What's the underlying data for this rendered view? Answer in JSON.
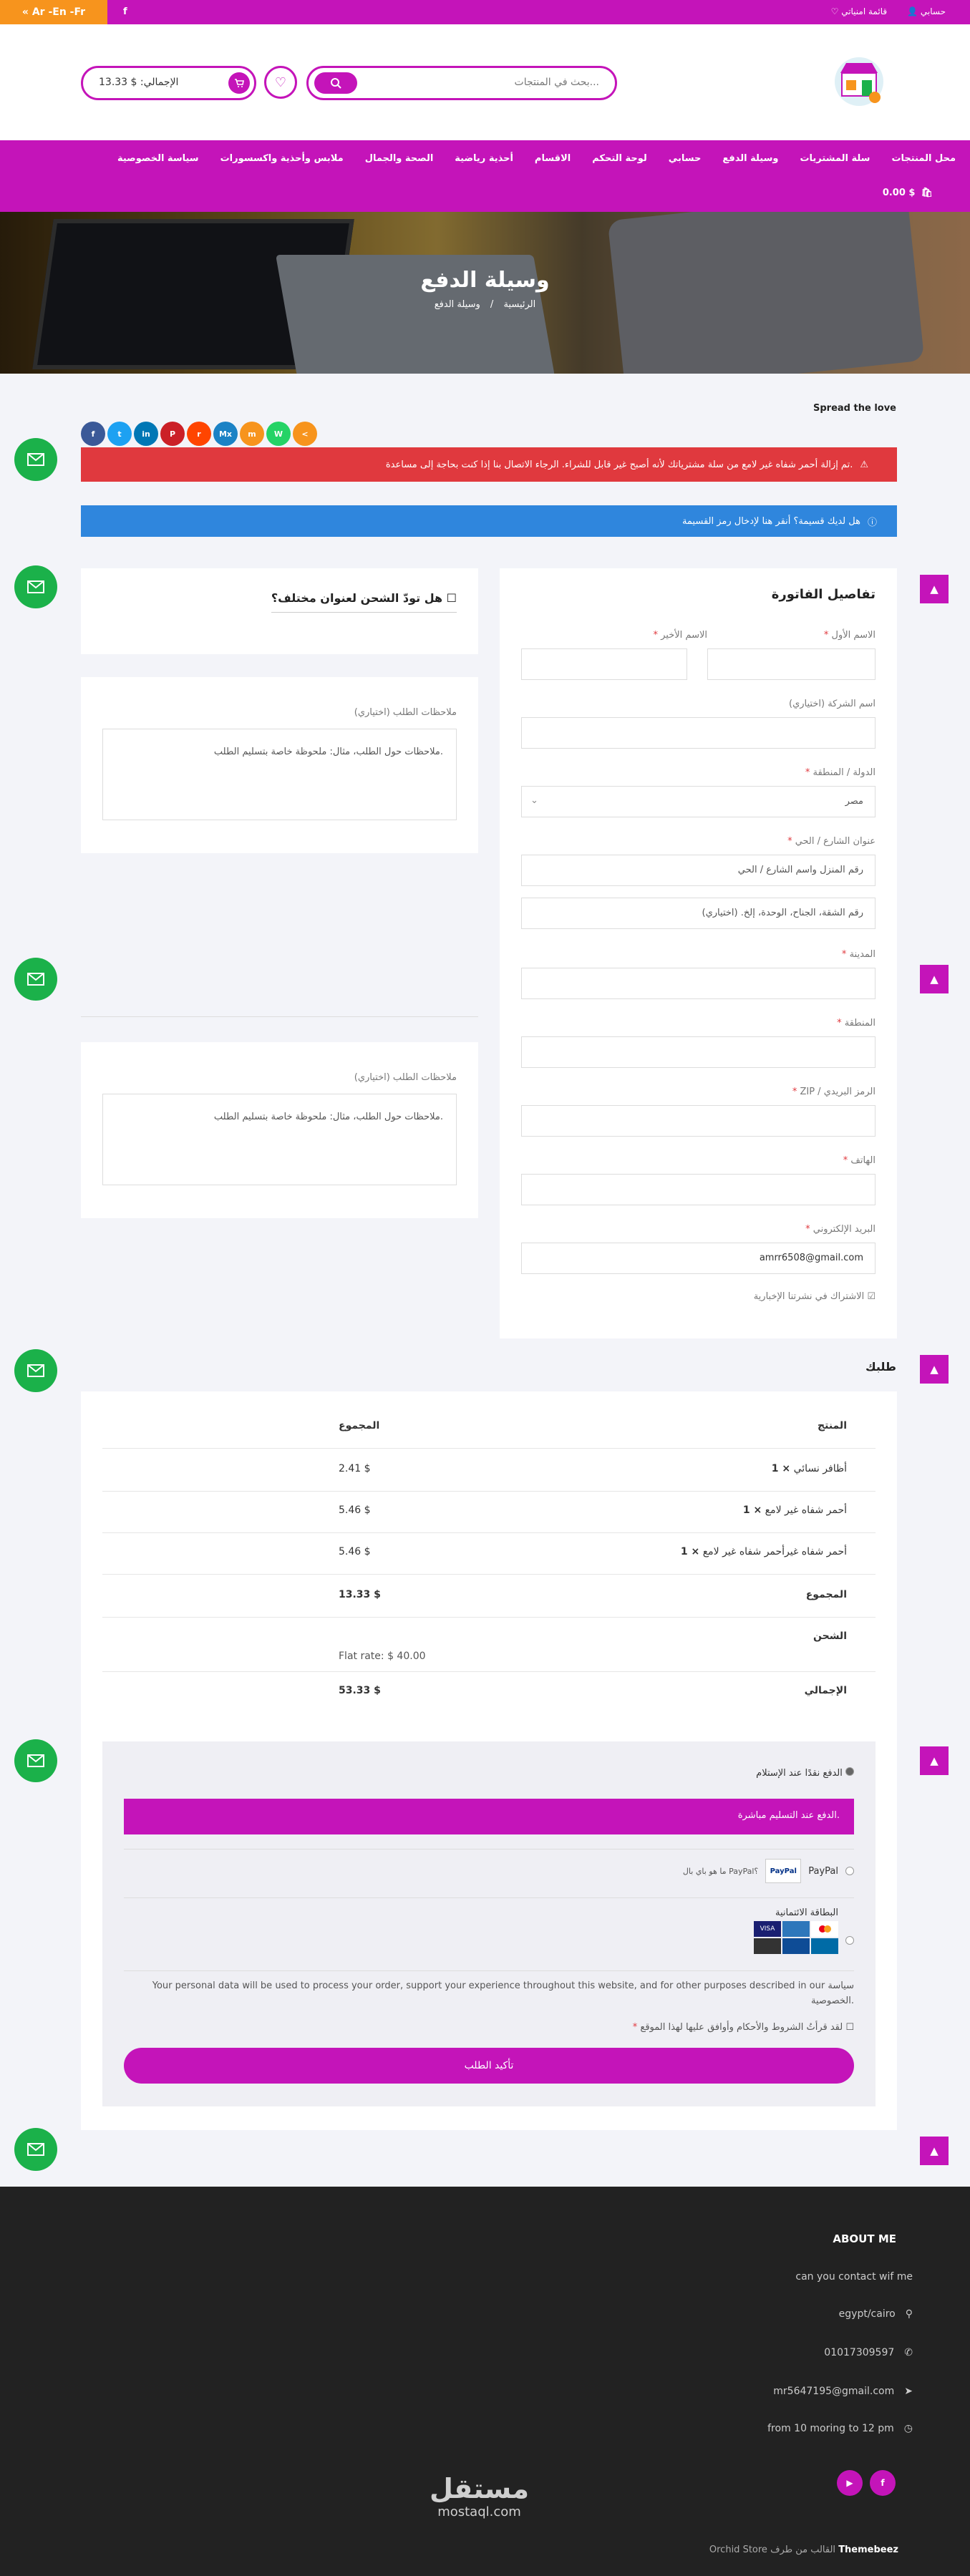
{
  "topbar": {
    "lang": "« Ar -En -Fr",
    "account": "حسابي",
    "wishlist": "قائمة امنياتي",
    "fb": "f"
  },
  "header": {
    "search_placeholder": "بحث في المنتجات...",
    "cart_total": "الإجمالي: $ 13.33"
  },
  "nav": {
    "items": [
      "محل المنتجات",
      "سلة المشتريات",
      "وسيلة الدفع",
      "حسابي",
      "لوحة التحكم",
      "الاقسام",
      "أحذية رياضية",
      "الصحة والجمال",
      "ملابس وأحذية واكسسورات",
      "سياسة الخصوصية"
    ],
    "cart": "0.00 $"
  },
  "hero": {
    "title": "وسيلة الدفع",
    "crumb_home": "الرئيسية",
    "crumb_sep": "/",
    "crumb_current": "وسيلة الدفع"
  },
  "share": {
    "title": "Spread the love",
    "buttons": [
      "f",
      "t",
      "in",
      "P",
      "r",
      "Mx",
      "m",
      "W",
      "<"
    ]
  },
  "alerts": {
    "error": "تم إزالة أحمر شفاه غير لامع من سلة مشترياتك لأنه أصبح غير قابل للشراء. الرجاء الاتصال بنا إذا كنت بحاجة إلى مساعدة.",
    "coupon": "هل لديك قسيمة؟ أنقر هنا لإدخال رمز القسيمة"
  },
  "billing": {
    "title": "تفاصيل الفاتورة",
    "first_name": "الاسم الأول",
    "last_name": "الاسم الأخير",
    "company": "اسم الشركة (اختياري)",
    "country_label": "الدولة / المنطقة",
    "country_value": "مصر",
    "street_label": "عنوان الشارع / الحي",
    "street_ph": "رقم المنزل واسم الشارع / الحي",
    "street2_ph": "رقم الشقة، الجناح، الوحدة، إلخ. (اختياري)",
    "city": "المدينة",
    "region": "المنطقة",
    "zip": "ZIP / الرمز البريدي",
    "phone": "الهاتف",
    "email_label": "البريد الإلكتروني",
    "email_value": "amrr6508@gmail.com",
    "newsletter": "الاشتراك في نشرتنا الإخبارية",
    "req": "*"
  },
  "shipping": {
    "different": "هل تودّ الشحن لعنوان مختلف؟",
    "notes_label": "ملاحظات الطلب (اختياري)",
    "notes_ph": "ملاحظات حول الطلب، مثال: ملحوظة خاصة بتسليم الطلب."
  },
  "order": {
    "title": "طلبك",
    "col_product": "المنتج",
    "col_total": "المجموع",
    "items": [
      {
        "name": "أظافر نسائي",
        "qty": "× 1",
        "total": "2.41 $"
      },
      {
        "name": "أحمر شفاه غير لامع",
        "qty": "× 1",
        "total": "5.46 $"
      },
      {
        "name": "أحمر شفاه غيرأحمر شفاه غير لامع",
        "qty": "× 1",
        "total": "5.46 $"
      }
    ],
    "subtotal_label": "المجموع",
    "subtotal": "13.33 $",
    "shipping_label": "الشحن",
    "shipping": "Flat rate: $ 40.00",
    "total_label": "الإجمالي",
    "total": "53.33 $"
  },
  "payment": {
    "cod": "الدفع نقدًا عند الإستلام",
    "cod_desc": "الدفع عند التسليم مباشرة.",
    "paypal": "PayPal",
    "paypal_link": "ما هو باي بال PayPal؟",
    "card": "البطاقة الائتمانية",
    "privacy": "Your personal data will be used to process your order, support your experience throughout this website, and for other purposes described in our سياسة الخصوصية.",
    "terms": "لقد قرأتُ الشروط والأحكام وأوافق عليها لهذا الموقع",
    "submit": "تأكيد الطلب",
    "card_brands": [
      "VISA",
      "",
      "",
      "",
      "",
      ""
    ]
  },
  "footer": {
    "title": "ABOUT ME",
    "tagline": "can you contact wif me",
    "address": "egypt/cairo",
    "phone": "01017309597",
    "email": "mr5647195@gmail.com",
    "hours": "from 10 moring to 12 pm",
    "credit_theme": "Orchid Store",
    "credit_by": "القالب من طرف",
    "credit_author": "Themebeez",
    "watermark": "مستقل",
    "watermark2": "mostaql.com"
  },
  "colors": {
    "brand": "#c414b9",
    "orange": "#f7941d",
    "green": "#1bb14a",
    "red": "#e0393e",
    "blue": "#2f86dd"
  }
}
